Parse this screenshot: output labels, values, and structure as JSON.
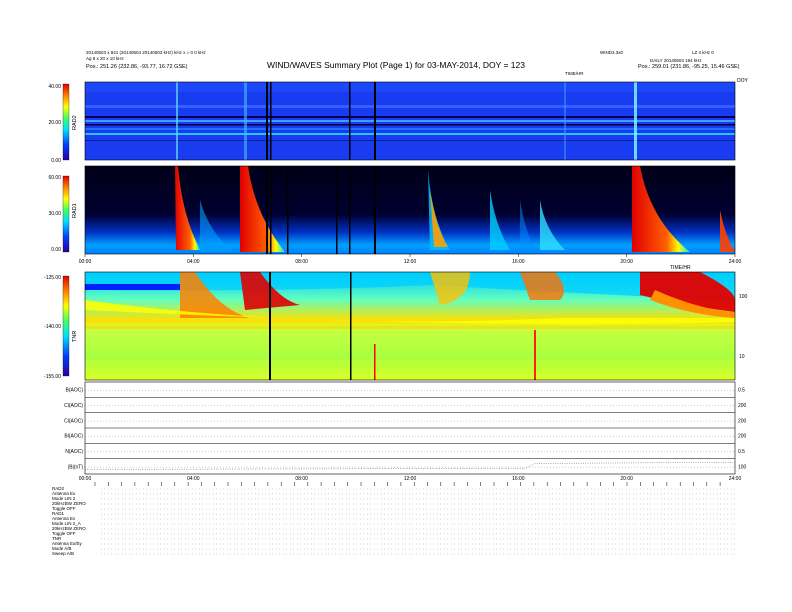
{
  "header": {
    "title": "WIND/WAVES Summary Plot (Page 1) for 03-MAY-2014, DOY = 123",
    "left_line1": "20140503 x 841 (20140504 20140503 kHz) kHz  x = 0  0 kHz",
    "left_line2": "Ag 8 x 20 x 10 kHz",
    "left_position": "Pos.:  251.26 (232.86, -93.77, 16.72 GSE)",
    "right_top_a": "WIND3.3x0",
    "right_top_b": "LZ 4 kHz 0",
    "right_line1": "DAILY 20140504 194 kHz",
    "right_position": "Pos.:  259.01 (231.86, -95.25, 15.46 GSE)",
    "label_tnr_time": "TIME/HR",
    "label_rad1_time": "RAD1"
  },
  "chart_data": [
    {
      "type": "heatmap",
      "name_label": "RAD2",
      "colorbar_ticks": [
        "40.00",
        "20.00",
        "0.00"
      ],
      "top_right_label": "DOY"
    },
    {
      "type": "heatmap",
      "name_label": "RAD1",
      "colorbar_ticks": [
        "60.00",
        "30.00",
        "0.00"
      ],
      "time_ticks": [
        "00:00",
        "04:00",
        "08:00",
        "12:00",
        "16:00",
        "20:00",
        "24:00"
      ]
    },
    {
      "type": "heatmap",
      "name_label": "TNR",
      "colorbar_ticks": [
        "-125.00",
        "-140.00",
        "-155.00"
      ],
      "right_ticks": [
        "100",
        "10"
      ],
      "top_label": "TIME/HR"
    },
    {
      "type": "line",
      "rows": [
        {
          "label": "B(AOC)",
          "right": "0.5"
        },
        {
          "label": "Cl(AOC)",
          "right": "200"
        },
        {
          "label": "Cl(AOC)",
          "right": "200"
        },
        {
          "label": "Bl(AOC)",
          "right": "200"
        },
        {
          "label": "N(AOC)",
          "right": "0.5"
        },
        {
          "label": "|B|(nT)",
          "right": "100"
        }
      ],
      "time_ticks": [
        "00:00",
        "04:00",
        "08:00",
        "12:00",
        "16:00",
        "20:00",
        "24:00"
      ]
    }
  ],
  "footer": {
    "lines": [
      "RAD2",
      "Antenna   Ex",
      "Mode   LIN 2",
      "20kHzBW   ZERO",
      "Toggle   OFF",
      "RAD1",
      "Antenna   Ex",
      "Mode   LIN 2_A",
      "20kHzBW   ZERO",
      "Toggle   OFF",
      "TNR",
      "Antenna   Ex/Ey",
      "Mode   A/B",
      "Sweep   A/B"
    ]
  },
  "colors": {
    "background_blue": "#1a3cf0",
    "dark": "#000010",
    "hot": "#d01010"
  }
}
